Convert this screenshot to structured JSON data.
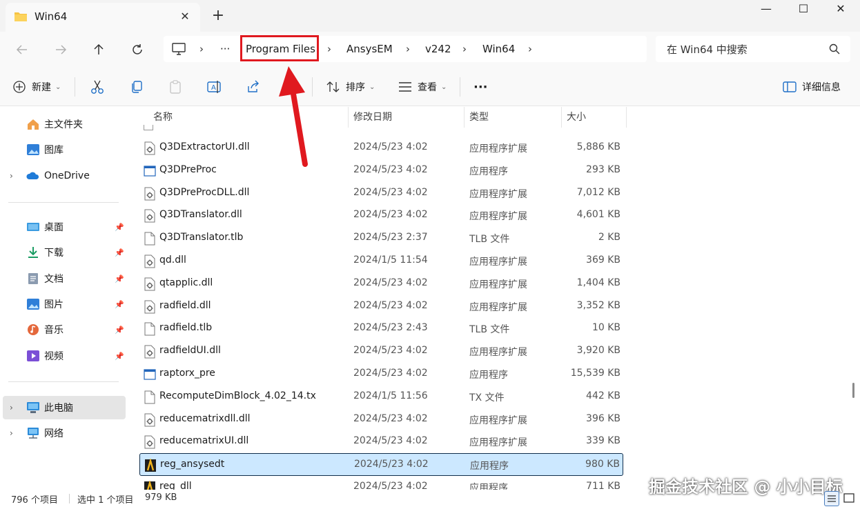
{
  "window": {
    "tab_title": "Win64",
    "close_tab": "✕",
    "new_tab": "+",
    "minimize": "—",
    "maximize": "☐",
    "close": "✕"
  },
  "address": {
    "overflow": "···",
    "crumbs": [
      "Program Files",
      "AnsysEM",
      "v242",
      "Win64"
    ],
    "separator": "›"
  },
  "search": {
    "placeholder": "在 Win64 中搜索"
  },
  "toolbar": {
    "new_label": "新建",
    "sort_label": "排序",
    "view_label": "查看",
    "more_label": "···",
    "details_label": "详细信息"
  },
  "sidebar": {
    "top_items": [
      {
        "label": "主文件夹",
        "icon": "home-icon"
      },
      {
        "label": "图库",
        "icon": "gallery-icon"
      },
      {
        "label": "OneDrive",
        "icon": "cloud-icon"
      }
    ],
    "pinned": [
      {
        "label": "桌面",
        "icon": "desktop-icon"
      },
      {
        "label": "下载",
        "icon": "download-icon"
      },
      {
        "label": "文档",
        "icon": "document-icon"
      },
      {
        "label": "图片",
        "icon": "pictures-icon"
      },
      {
        "label": "音乐",
        "icon": "music-icon"
      },
      {
        "label": "视频",
        "icon": "video-icon"
      }
    ],
    "bottom_items": [
      {
        "label": "此电脑",
        "icon": "computer-icon"
      },
      {
        "label": "网络",
        "icon": "network-icon"
      }
    ]
  },
  "columns": {
    "name": "名称",
    "date": "修改日期",
    "type": "类型",
    "size": "大小"
  },
  "files": [
    {
      "name": "Q3DExtractorUI.dll",
      "date": "2024/5/23 4:02",
      "type": "应用程序扩展",
      "size": "5,886 KB",
      "kind": "dll"
    },
    {
      "name": "Q3DPreProc",
      "date": "2024/5/23 4:02",
      "type": "应用程序",
      "size": "293 KB",
      "kind": "exe"
    },
    {
      "name": "Q3DPreProcDLL.dll",
      "date": "2024/5/23 4:02",
      "type": "应用程序扩展",
      "size": "7,012 KB",
      "kind": "dll"
    },
    {
      "name": "Q3DTranslator.dll",
      "date": "2024/5/23 4:02",
      "type": "应用程序扩展",
      "size": "4,601 KB",
      "kind": "dll"
    },
    {
      "name": "Q3DTranslator.tlb",
      "date": "2024/5/23 2:37",
      "type": "TLB 文件",
      "size": "2 KB",
      "kind": "file"
    },
    {
      "name": "qd.dll",
      "date": "2024/1/5 11:54",
      "type": "应用程序扩展",
      "size": "369 KB",
      "kind": "dll"
    },
    {
      "name": "qtapplic.dll",
      "date": "2024/5/23 4:02",
      "type": "应用程序扩展",
      "size": "1,404 KB",
      "kind": "dll"
    },
    {
      "name": "radfield.dll",
      "date": "2024/5/23 4:02",
      "type": "应用程序扩展",
      "size": "3,352 KB",
      "kind": "dll"
    },
    {
      "name": "radfield.tlb",
      "date": "2024/5/23 2:43",
      "type": "TLB 文件",
      "size": "10 KB",
      "kind": "file"
    },
    {
      "name": "radfieldUI.dll",
      "date": "2024/5/23 4:02",
      "type": "应用程序扩展",
      "size": "3,920 KB",
      "kind": "dll"
    },
    {
      "name": "raptorx_pre",
      "date": "2024/5/23 4:02",
      "type": "应用程序",
      "size": "15,539 KB",
      "kind": "exe"
    },
    {
      "name": "RecomputeDimBlock_4.02_14.tx",
      "date": "2024/1/5 11:56",
      "type": "TX 文件",
      "size": "442 KB",
      "kind": "file"
    },
    {
      "name": "reducematrixdll.dll",
      "date": "2024/5/23 4:02",
      "type": "应用程序扩展",
      "size": "396 KB",
      "kind": "dll"
    },
    {
      "name": "reducematrixUI.dll",
      "date": "2024/5/23 4:02",
      "type": "应用程序扩展",
      "size": "339 KB",
      "kind": "dll"
    },
    {
      "name": "reg_ansysedt",
      "date": "2024/5/23 4:02",
      "type": "应用程序",
      "size": "980 KB",
      "kind": "ansys",
      "selected": true
    },
    {
      "name": "reg_dll",
      "date": "2024/5/23 4:02",
      "type": "应用程序",
      "size": "711 KB",
      "kind": "ansys"
    }
  ],
  "status": {
    "count": "796 个项目",
    "selected": "选中 1 个项目",
    "selected_size": "979 KB"
  },
  "watermark": "掘金技术社区 @ 小小目标",
  "colors": {
    "highlight": "#e0191f",
    "arrow": "#e0191f",
    "selection": "#cce8ff"
  }
}
